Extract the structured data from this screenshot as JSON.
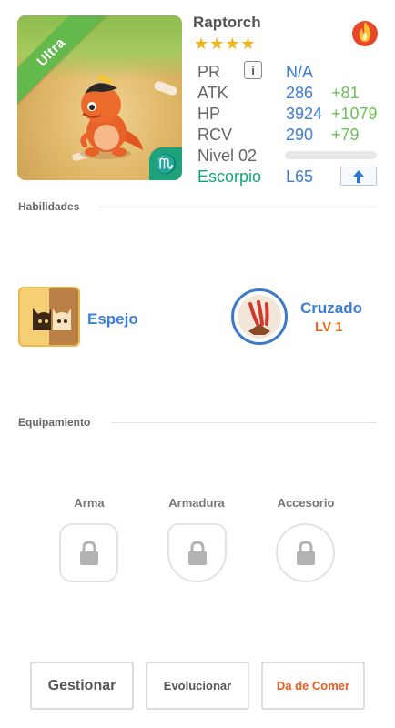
{
  "monster": {
    "name": "Raptorch",
    "rarity": "Ultra",
    "stars": "★★★★",
    "element_icon": "fire-icon",
    "zodiac_symbol": "♏"
  },
  "stats": {
    "pr": {
      "label": "PR",
      "value": "N/A"
    },
    "atk": {
      "label": "ATK",
      "value": "286",
      "bonus": "+81"
    },
    "hp": {
      "label": "HP",
      "value": "3924",
      "bonus": "+1079"
    },
    "rcv": {
      "label": "RCV",
      "value": "290",
      "bonus": "+79"
    },
    "level": {
      "label": "Nivel 02",
      "progress": 0
    },
    "zodiac": "Escorpio",
    "level_cap": "L65",
    "info_label": "i"
  },
  "abilities": {
    "title": "Habilidades",
    "items": [
      {
        "name": "Espejo",
        "icon": "mirror-cat-icon"
      },
      {
        "name": "Cruzado",
        "level": "LV 1",
        "icon": "claw-slash-icon"
      }
    ]
  },
  "equipment": {
    "title": "Equipamiento",
    "slots": [
      {
        "label": "Arma",
        "icon": "lock-icon"
      },
      {
        "label": "Armadura",
        "icon": "lock-icon"
      },
      {
        "label": "Accesorio",
        "icon": "lock-icon"
      }
    ]
  },
  "actions": {
    "manage": "Gestionar",
    "evolve": "Evolucionar",
    "feed": "Da de Comer"
  },
  "colors": {
    "accent_blue": "#3b7dd8",
    "bonus_green": "#6cc257",
    "zodiac_green": "#13a37b",
    "feed_orange": "#ef5a1e",
    "rarity_ribbon": "#64b94c"
  }
}
